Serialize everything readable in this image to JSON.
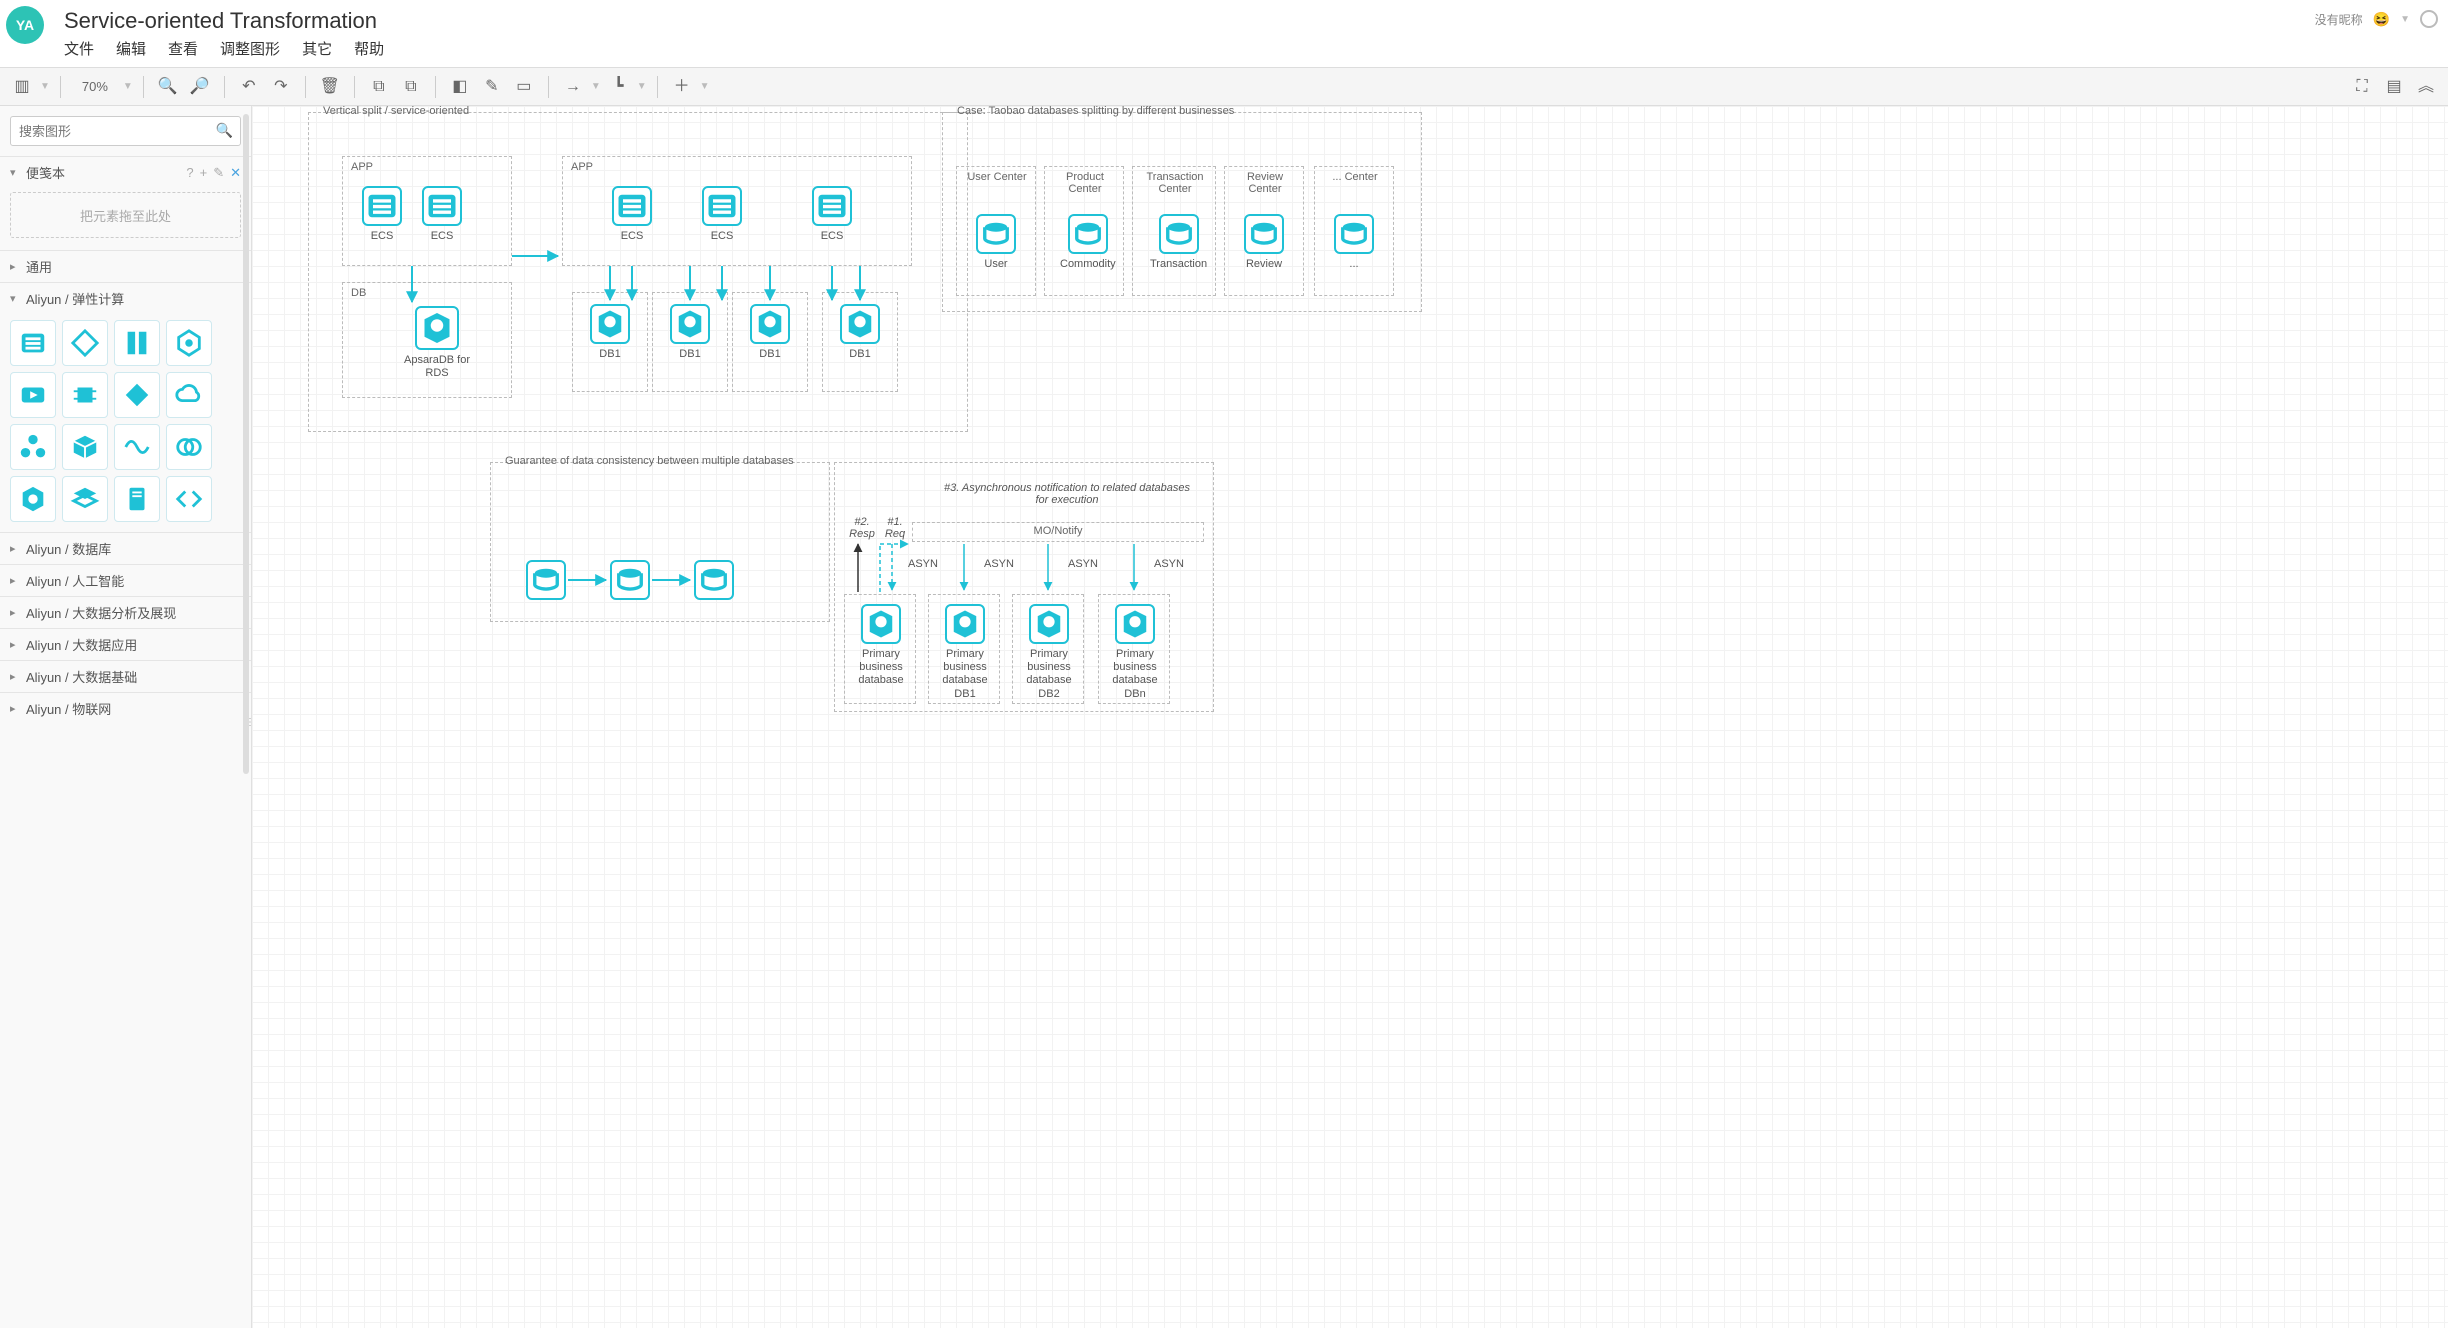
{
  "header": {
    "avatar_initials": "YA",
    "title": "Service-oriented Transformation",
    "menu": [
      "文件",
      "编辑",
      "查看",
      "调整图形",
      "其它",
      "帮助"
    ],
    "user_label": "没有昵称",
    "user_emoji": "😆"
  },
  "toolbar": {
    "zoom": "70%"
  },
  "sidebar": {
    "search_placeholder": "搜索图形",
    "scratchpad_title": "便笺本",
    "scratchpad_hint": "把元素拖至此处",
    "panels": [
      {
        "label": "通用",
        "open": false
      },
      {
        "label": "Aliyun / 弹性计算",
        "open": true
      },
      {
        "label": "Aliyun / 数据库",
        "open": false
      },
      {
        "label": "Aliyun / 人工智能",
        "open": false
      },
      {
        "label": "Aliyun / 大数据分析及展现",
        "open": false
      },
      {
        "label": "Aliyun / 大数据应用",
        "open": false
      },
      {
        "label": "Aliyun / 大数据基础",
        "open": false
      },
      {
        "label": "Aliyun / 物联网",
        "open": false
      }
    ]
  },
  "diagram": {
    "groups": {
      "g_vs": "Vertical split / service-oriented",
      "g_app1": "APP",
      "g_app2": "APP",
      "g_db": "DB",
      "g_case": "Case: Taobao databases splitting by different businesses",
      "g_uc": "User Center",
      "g_pc": "Product Center",
      "g_tc": "Transaction Center",
      "g_rc": "Review Center",
      "g_xc": "... Center",
      "g_cons": "Guarantee of data consistency between multiple databases",
      "g_mo": "MO/Notify"
    },
    "labels": {
      "ecs": "ECS",
      "rds": "ApsaraDB for RDS",
      "db1": "DB1",
      "user": "User",
      "commodity": "Commodity",
      "transaction": "Transaction",
      "review": "Review",
      "dots": "...",
      "async_note": "#3. Asynchronous notification to related databases for execution",
      "resp": "#2. Resp",
      "req": "#1. Req",
      "asyn": "ASYN",
      "pbd": "Primary business database",
      "pbd1": "Primary business database DB1",
      "pbd2": "Primary business database DB2",
      "pbdn": "Primary business database DBn"
    }
  }
}
